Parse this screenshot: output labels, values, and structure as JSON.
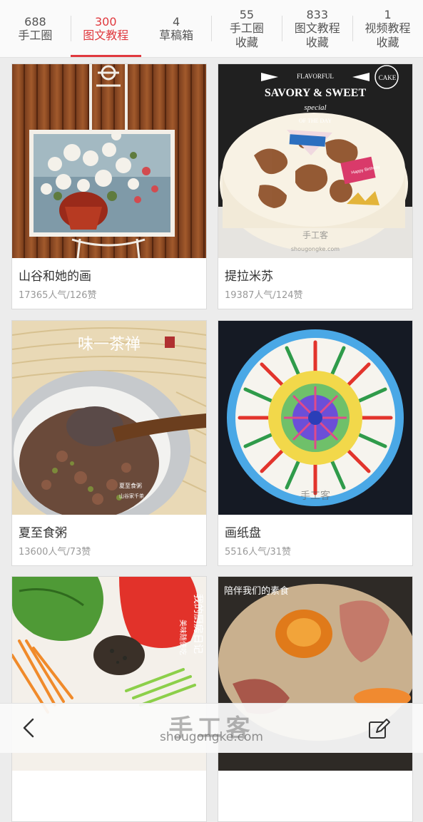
{
  "tabs": [
    {
      "count": "688",
      "label": "手工圈",
      "label2": ""
    },
    {
      "count": "300",
      "label": "图文教程",
      "label2": ""
    },
    {
      "count": "4",
      "label": "草稿箱",
      "label2": ""
    },
    {
      "count": "55",
      "label": "手工圈",
      "label2": "收藏"
    },
    {
      "count": "833",
      "label": "图文教程",
      "label2": "收藏"
    },
    {
      "count": "1",
      "label": "视频教程",
      "label2": "收藏"
    }
  ],
  "active_tab": 1,
  "cards": [
    {
      "title": "山谷和她的画",
      "meta": "17365人气/126赞"
    },
    {
      "title": "提拉米苏",
      "meta": "19387人气/124赞"
    },
    {
      "title": "夏至食粥",
      "meta": "13600人气/73赞"
    },
    {
      "title": "画纸盘",
      "meta": "5516人气/31赞"
    },
    {
      "title": "",
      "meta": ""
    },
    {
      "title": "",
      "meta": ""
    }
  ],
  "photo_text": {
    "cake_banner": "FLAVORFUL",
    "cake_title": "SAVORY & SWEET",
    "cake_special": "special",
    "cake_day": "OF THE DAY",
    "cake_top_right": "CAKE",
    "cake_tag": "Happy Birthday",
    "cake_wm": "手工客",
    "cake_wm_url": "shougongke.com",
    "porridge_calligraphy": "味一茶禅",
    "porridge_note1": "夏至食粥",
    "porridge_note2": "山谷家千茶",
    "plate_wm": "手工客",
    "noodle_text1": "我的厨房日记",
    "noodle_text2": "美味随便吃",
    "rice_text": "陪伴我们的素食"
  },
  "watermark": {
    "cn": "手工客",
    "en": "shougongke.com"
  },
  "icons": {
    "back": "chevron-left-icon",
    "edit": "edit-icon"
  },
  "colors": {
    "accent": "#e0393e",
    "text": "#333333",
    "meta": "#999999",
    "background": "#ececec"
  }
}
